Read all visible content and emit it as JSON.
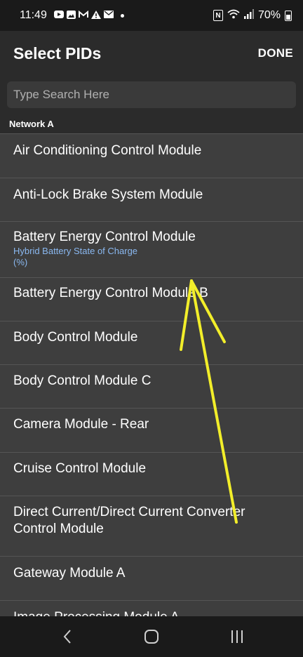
{
  "status_bar": {
    "time": "11:49",
    "battery": "70%",
    "icons": [
      "youtube-icon",
      "photos-icon",
      "gmail-icon",
      "alert-icon",
      "mail-icon",
      "nfc-icon",
      "wifi-icon",
      "signal-icon",
      "battery-icon"
    ]
  },
  "app_bar": {
    "title": "Select PIDs",
    "done_label": "DONE"
  },
  "search": {
    "placeholder": "Type Search Here",
    "value": ""
  },
  "section": {
    "title": "Network A"
  },
  "modules": [
    {
      "title": "Air Conditioning Control Module"
    },
    {
      "title": "Anti-Lock Brake System Module"
    },
    {
      "title": "Battery Energy Control Module",
      "subtitle": "Hybrid Battery State of Charge",
      "subtitle2": "(%)"
    },
    {
      "title": "Battery Energy Control Module B"
    },
    {
      "title": "Body Control Module"
    },
    {
      "title": "Body Control Module C"
    },
    {
      "title": "Camera Module - Rear"
    },
    {
      "title": "Cruise Control Module"
    },
    {
      "title": "Direct Current/Direct Current Converter",
      "title2": "Control Module"
    },
    {
      "title": "Gateway Module A"
    },
    {
      "title": "Image Processing Module A"
    }
  ],
  "colors": {
    "background": "#3e3e3e",
    "header": "#2b2b2b",
    "subtitle": "#8ab8f0",
    "annotation": "#f2ee2a"
  }
}
